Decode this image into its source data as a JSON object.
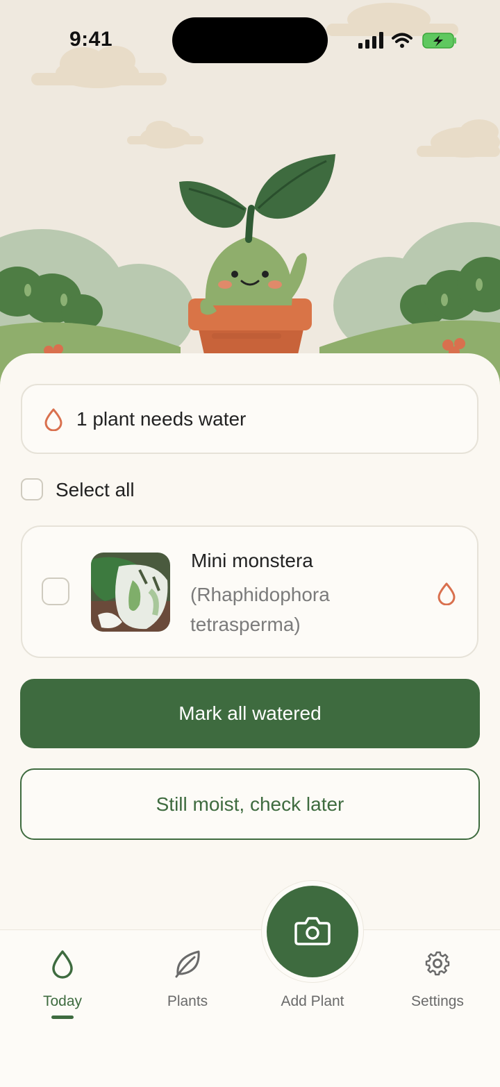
{
  "status_bar": {
    "time": "9:41",
    "icons": [
      "signal-icon",
      "wifi-icon",
      "battery-charging-icon"
    ]
  },
  "colors": {
    "primary": "#3e6b3f",
    "water_accent": "#d9704e",
    "background": "#fbf8f2"
  },
  "hero": {
    "illustration": "sprout-mascot-in-pot"
  },
  "summary": {
    "icon": "water-drop-icon",
    "text": "1 plant needs water"
  },
  "select_all": {
    "label": "Select all",
    "checked": false
  },
  "plants": [
    {
      "name": "Mini monstera",
      "scientific_name": "(Rhaphidophora tetrasperma)",
      "checked": false,
      "status_icon": "water-drop-icon"
    }
  ],
  "actions": {
    "primary": "Mark all watered",
    "secondary": "Still moist, check later"
  },
  "tabs": [
    {
      "label": "Today",
      "icon": "water-drop-icon",
      "active": true
    },
    {
      "label": "Plants",
      "icon": "leaf-icon",
      "active": false
    },
    {
      "label": "Add Plant",
      "icon": "camera-icon",
      "active": false
    },
    {
      "label": "Settings",
      "icon": "gear-icon",
      "active": false
    }
  ]
}
